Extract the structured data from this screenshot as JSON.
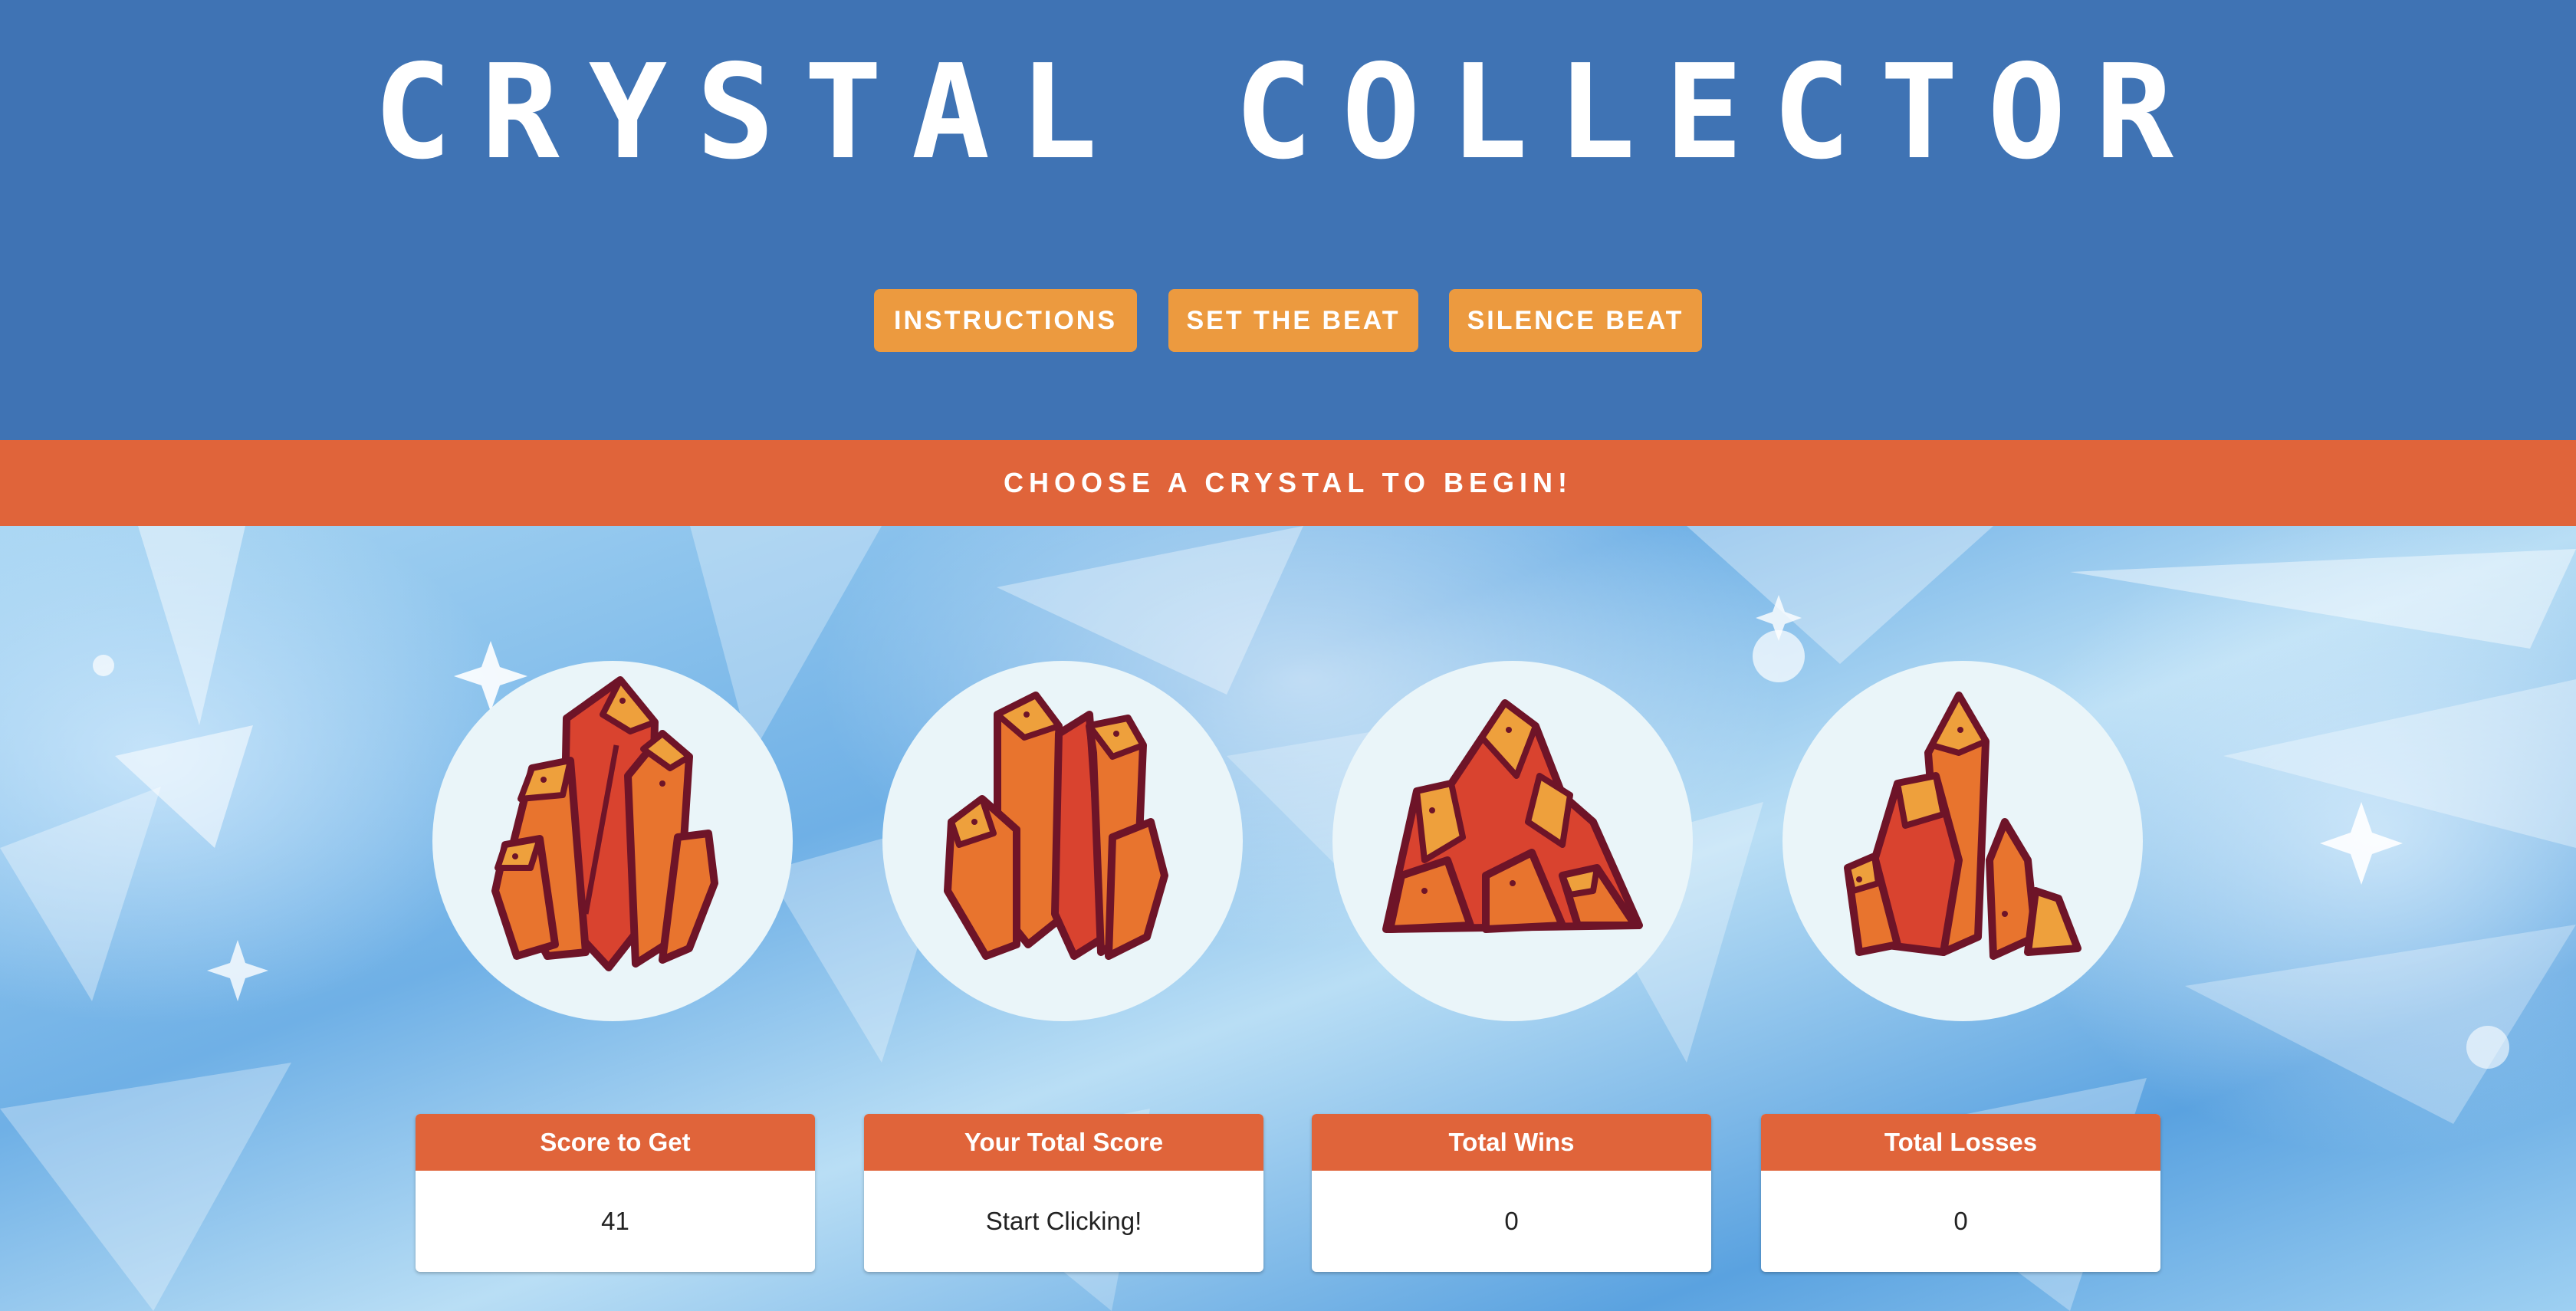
{
  "header": {
    "title": "CRYSTAL COLLECTOR",
    "buttons": {
      "instructions": "INSTRUCTIONS",
      "set_beat": "SET THE BEAT",
      "silence_beat": "SILENCE BEAT"
    }
  },
  "banner": {
    "message": "CHOOSE A CRYSTAL TO BEGIN!"
  },
  "crystals": [
    {
      "icon": "crystal-cluster-icon"
    },
    {
      "icon": "crystal-cluster-icon"
    },
    {
      "icon": "crystal-cluster-icon"
    },
    {
      "icon": "crystal-cluster-icon"
    }
  ],
  "scoreboard": {
    "target": {
      "label": "Score to Get",
      "value": "41"
    },
    "total": {
      "label": "Your Total Score",
      "value": "Start Clicking!"
    },
    "wins": {
      "label": "Total Wins",
      "value": "0"
    },
    "losses": {
      "label": "Total Losses",
      "value": "0"
    }
  },
  "colors": {
    "header_bg": "#3f73b4",
    "accent_orange": "#e0643a",
    "button_orange": "#ec9a3f",
    "crystal_dark": "#6e1428",
    "crystal_red": "#d9432f",
    "crystal_orange": "#e8742e",
    "crystal_yellow": "#eea03c"
  }
}
